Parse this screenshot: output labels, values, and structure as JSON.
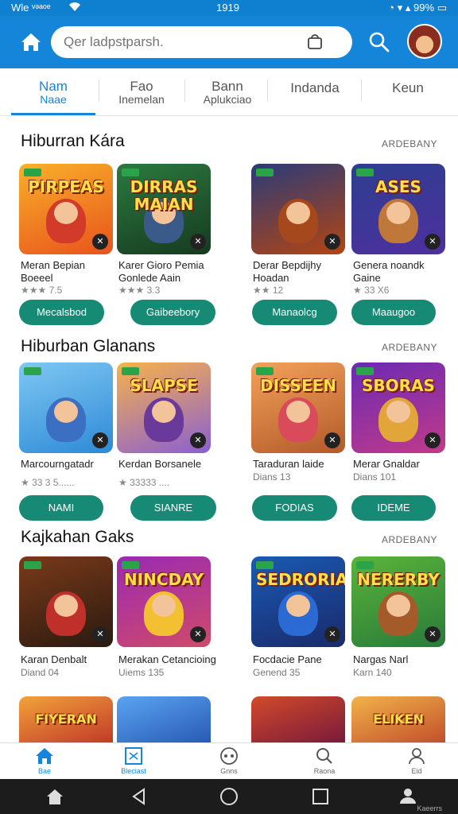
{
  "status": {
    "left": "Wle ᵛᵊᵃᵒᵉ",
    "time": "1919",
    "battery": "99%"
  },
  "search": {
    "placeholder": "Qer ladpstparsh."
  },
  "tabs": [
    {
      "line1": "Nam",
      "line2": "Naae"
    },
    {
      "line1": "Fao",
      "line2": "Inemelan"
    },
    {
      "line1": "Bann",
      "line2": "Aplukciao"
    },
    {
      "line1": "Indanda",
      "line2": ""
    },
    {
      "line1": "Keun",
      "line2": ""
    }
  ],
  "sections": [
    {
      "title": "Hiburran Kára",
      "more": "ARDEBANY",
      "items": [
        {
          "title_line1": "Meran Bepian",
          "title_line2": "Boeeel",
          "rating": "★★★ 7.5",
          "button": "Mecalsbod",
          "logo": "PIRPEAS",
          "bg": [
            "#f9b02a",
            "#e8531c"
          ],
          "hero": "#d23a2a"
        },
        {
          "title_line1": "Karer Gioro Pemia",
          "title_line2": "Gonlede Aain",
          "rating": "★★★ 3.3",
          "button": "Gaibeebory",
          "logo": "DIRRAS MAIAN",
          "bg": [
            "#2b7a3f",
            "#173a20"
          ],
          "hero": "#3a5a8a"
        },
        {
          "title_line1": "Derar Bepdijhy",
          "title_line2": "Hoadan",
          "rating": "★★ 12",
          "button": "Manaolcg",
          "logo": "",
          "bg": [
            "#2a3b7a",
            "#b34512"
          ],
          "hero": "#a5481c"
        },
        {
          "title_line1": "Genera noandk",
          "title_line2": "Gaine",
          "rating": "★ 33 X6",
          "button": "Maaugoo",
          "logo": "ASES",
          "bg": [
            "#2c3f8e",
            "#4f2fa0"
          ],
          "hero": "#c0783a"
        }
      ]
    },
    {
      "title": "Hiburban Glanans",
      "more": "ARDEBANY",
      "items": [
        {
          "title_line1": "Marcourngatadr",
          "title_line2": "",
          "rating": "★ 33 3 5......",
          "button": "NAMI",
          "logo": "",
          "bg": [
            "#7fc7f2",
            "#2d8ad6"
          ],
          "hero": "#3a6fc2"
        },
        {
          "title_line1": "Kerdan Borsanele",
          "title_line2": "",
          "rating": "★ 33333 ....",
          "button": "SIANRE",
          "logo": "SLAPSE",
          "bg": [
            "#f7b24a",
            "#8a5fd2"
          ],
          "hero": "#6a3a9a"
        },
        {
          "title_line1": "Taraduran laide",
          "title_line2": "Dians 13",
          "rating": "",
          "button": "FODIAS",
          "logo": "DISSEEN",
          "bg": [
            "#f3a15a",
            "#b35a2a"
          ],
          "hero": "#d94a5a"
        },
        {
          "title_line1": "Merar Gnaldar",
          "title_line2": "Dians 101",
          "rating": "",
          "button": "IDEME",
          "logo": "SBORAS",
          "bg": [
            "#6a2ab4",
            "#c23a8a"
          ],
          "hero": "#e2a53a"
        }
      ]
    },
    {
      "title": "Kajkahan Gaks",
      "more": "ARDEBANY",
      "items": [
        {
          "title_line1": "Karan Denbalt",
          "title_line2": "Diand 04",
          "rating": "",
          "button": "",
          "logo": "",
          "bg": [
            "#7a3a1a",
            "#2a1a10"
          ],
          "hero": "#c0302a"
        },
        {
          "title_line1": "Merakan Cetancioing",
          "title_line2": "Uiems 135",
          "rating": "",
          "button": "",
          "logo": "NINCDAY",
          "bg": [
            "#9a2ab4",
            "#d04a6a"
          ],
          "hero": "#f2c030"
        },
        {
          "title_line1": "Focdacie Pane",
          "title_line2": "Genend 35",
          "rating": "",
          "button": "",
          "logo": "SEDRORIAS",
          "bg": [
            "#1a5ab4",
            "#1a2a6a"
          ],
          "hero": "#2a6ad2"
        },
        {
          "title_line1": "Nargas Narl",
          "title_line2": "Karn 140",
          "rating": "",
          "button": "",
          "logo": "NERERBY",
          "bg": [
            "#5ab43a",
            "#2a7a3a"
          ],
          "hero": "#a55a2a"
        }
      ]
    }
  ],
  "peek_logos": [
    "FIYERAN",
    "",
    "",
    "ELIKEN"
  ],
  "bottom_nav": [
    "Bae",
    "Bleciast",
    "Gnns",
    "Raona",
    "Eid"
  ],
  "system_label": "Kaeerrs"
}
